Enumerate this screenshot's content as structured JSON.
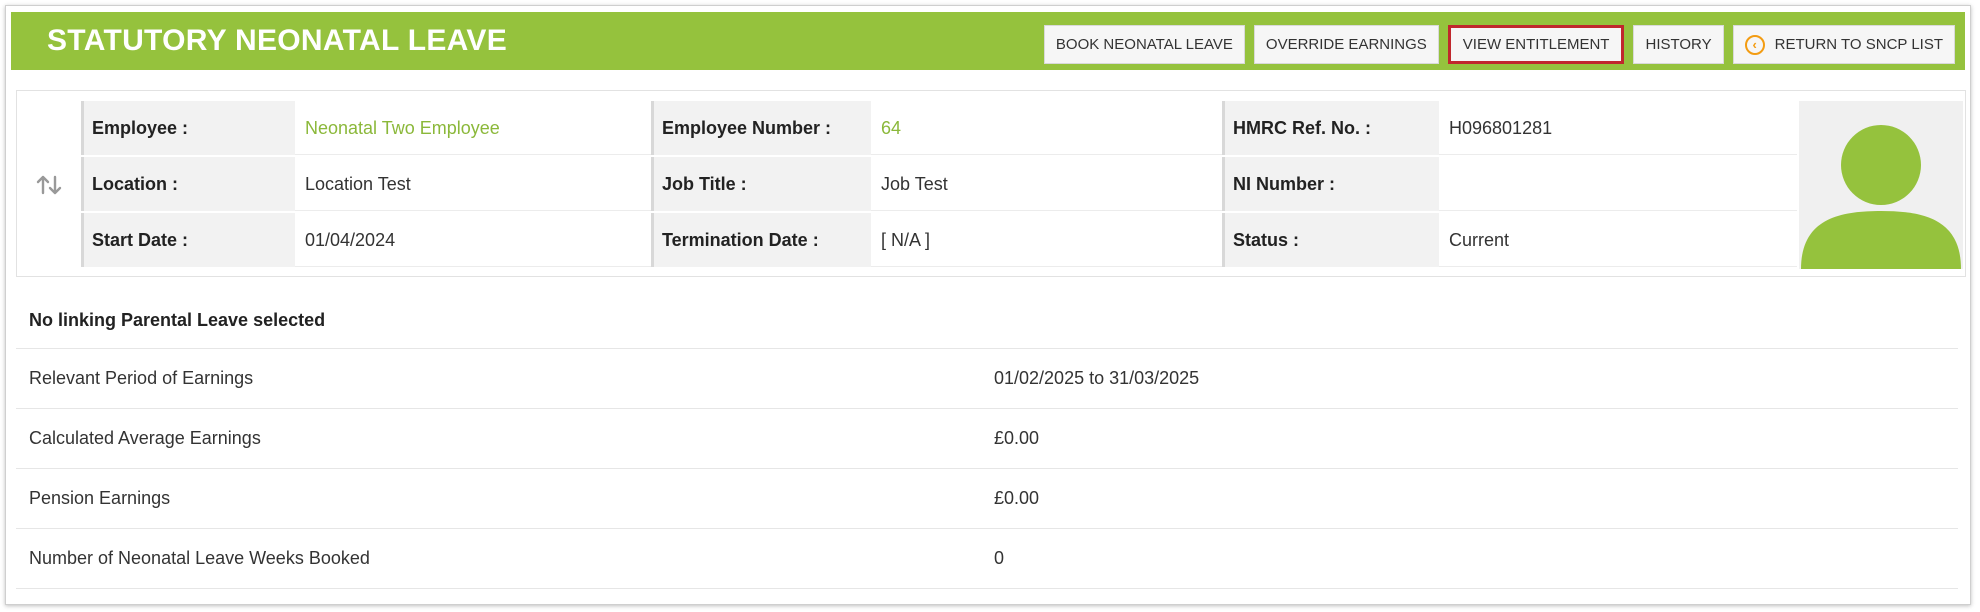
{
  "header": {
    "title": "STATUTORY NEONATAL LEAVE",
    "buttons": {
      "book": "BOOK NEONATAL LEAVE",
      "override": "OVERRIDE EARNINGS",
      "entitlement": "VIEW ENTITLEMENT",
      "history": "HISTORY",
      "return": "RETURN TO SNCP LIST"
    },
    "active_button": "entitlement",
    "icons": {
      "return": "chevron-left-circle-icon",
      "swap": "swap-vertical-icon",
      "avatar": "user-silhouette-icon"
    }
  },
  "employee": {
    "labels": {
      "employee": "Employee :",
      "employee_number": "Employee Number :",
      "hmrc_ref": "HMRC Ref. No. :",
      "location": "Location :",
      "job_title": "Job Title :",
      "ni_number": "NI Number :",
      "start_date": "Start Date :",
      "termination_date": "Termination Date :",
      "status": "Status :"
    },
    "values": {
      "employee": "Neonatal Two Employee",
      "employee_number": "64",
      "hmrc_ref": "H096801281",
      "location": "Location Test",
      "job_title": "Job Test",
      "ni_number": "",
      "start_date": "01/04/2024",
      "termination_date": "[ N/A ]",
      "status": "Current"
    }
  },
  "details": {
    "heading": "No linking Parental Leave selected",
    "rows": [
      {
        "label": "Relevant Period of Earnings",
        "value": "01/02/2025 to 31/03/2025"
      },
      {
        "label": "Calculated Average Earnings",
        "value": "£0.00"
      },
      {
        "label": "Pension Earnings",
        "value": "£0.00"
      },
      {
        "label": "Number of Neonatal Leave Weeks Booked",
        "value": "0"
      }
    ]
  },
  "colors": {
    "brand_green": "#95c23d",
    "link_green": "#8bb83a",
    "active_border": "#c0272d",
    "icon_orange": "#f39c12"
  }
}
